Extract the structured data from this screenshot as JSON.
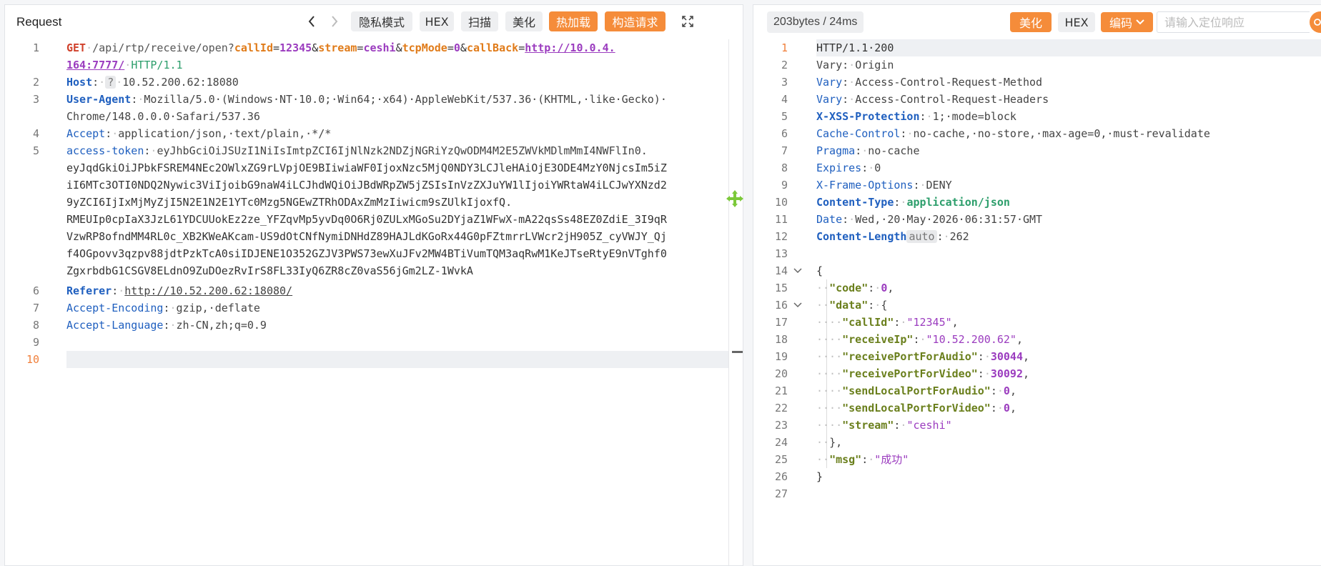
{
  "request": {
    "title": "Request",
    "toolbar": {
      "privacy": "隐私模式",
      "hex": "HEX",
      "scan": "扫描",
      "beautify": "美化",
      "hot_reload": "热加载",
      "construct": "构造请求"
    },
    "lines": [
      1,
      2,
      3,
      4,
      5,
      6,
      7,
      8,
      9,
      10
    ],
    "current_line": 10,
    "l1": {
      "method": "GET",
      "path": "/api/rtp/receive/open?",
      "k1": "callId",
      "v1": "12345",
      "k2": "stream",
      "v2": "ceshi",
      "k3": "tcpMode",
      "v3": "0",
      "k4": "callBack",
      "url_a": "http://10.0.4.",
      "url_b": "164:7777/",
      "proto": "HTTP/1.1"
    },
    "host": {
      "key": "Host",
      "badge": "?",
      "value": "10.52.200.62:18080"
    },
    "ua": {
      "key": "User-Agent",
      "value_a": "Mozilla/5.0·(Windows·NT·10.0;·Win64;·x64)·AppleWebKit/537.36·(KHTML,·like·Gecko)·",
      "value_b": "Chrome/148.0.0.0·Safari/537.36"
    },
    "accept": {
      "key": "Accept",
      "value": "application/json,·text/plain,·*/*"
    },
    "token": {
      "key": "access-token",
      "lines": [
        "eyJhbGciOiJSUzI1NiIsImtpZCI6IjNlNzk2NDZjNGRiYzQwODM4M2E5ZWVkMDlmMmI4NWFlIn0.",
        "eyJqdGkiOiJPbkFSREM4NEc2OWlxZG9rLVpjOE9BIiwiaWF0IjoxNzc5MjQ0NDY3LCJleHAiOjE3ODE4MzY0NjcsIm5iZ",
        "iI6MTc3OTI0NDQ2Nywic3ViIjoibG9naW4iLCJhdWQiOiJBdWRpZW5jZSIsInVzZXJuYW1lIjoiYWRtaW4iLCJwYXNzd2",
        "9yZCI6IjIxMjMyZjI5N2E1N2E1YTc0Mzg5NGEwZTRhODAxZmMzIiwicm9sZUlkIjoxfQ.",
        "RMEUIp0cpIaX3JzL61YDCUUokEz2ze_YFZqvMp5yvDq0O6Rj0ZULxMGoSu2DYjaZ1WFwX-mA22qsSs48EZ0ZdiE_3I9qR",
        "VzwRP8ofndMM4RL0c_XB2KWeAKcam-US9dOtCNfNymiDNHdZ89HAJLdKGoRx44G0pFZtmrrLVWcr2jH905Z_cyVWJY_Qj",
        "f4OGpovv3qzpv88jdtPzkTcA0siIDJENE1O352GZJV3PWS73ewXuJFv2MW4BTiVumTQM3aqRwM1KeJTseRtyE9nVTghf0",
        "ZgxrbdbG1CSGV8ELdnO9ZuDOezRvIrS8FL33IyQ6ZR8cZ0vaS56jGm2LZ-1WvkA"
      ]
    },
    "referer": {
      "key": "Referer",
      "value": "http://10.52.200.62:18080/"
    },
    "encoding": {
      "key": "Accept-Encoding",
      "value": "gzip,·deflate"
    },
    "language": {
      "key": "Accept-Language",
      "value": "zh-CN,zh;q=0.9"
    }
  },
  "response": {
    "stats": "203bytes / 24ms",
    "toolbar": {
      "beautify": "美化",
      "hex": "HEX",
      "encoding": "编码"
    },
    "search_placeholder": "请输入定位响应",
    "lines": [
      1,
      2,
      3,
      4,
      5,
      6,
      7,
      8,
      9,
      10,
      11,
      12,
      13,
      14,
      15,
      16,
      17,
      18,
      19,
      20,
      21,
      22,
      23,
      24,
      25,
      26,
      27
    ],
    "status": "HTTP/1.1·200",
    "headers": [
      {
        "key": "Vary",
        "value": "Origin",
        "bold": false
      },
      {
        "key": "Vary",
        "value": "Access-Control-Request-Method",
        "bold": false
      },
      {
        "key": "Vary",
        "value": "Access-Control-Request-Headers",
        "bold": false
      },
      {
        "key": "X-XSS-Protection",
        "value": "1;·mode=block",
        "bold": true
      },
      {
        "key": "Cache-Control",
        "value": "no-cache,·no-store,·max-age=0,·must-revalidate",
        "bold": false
      },
      {
        "key": "Pragma",
        "value": "no-cache",
        "bold": false
      },
      {
        "key": "Expires",
        "value": "0",
        "bold": false
      },
      {
        "key": "X-Frame-Options",
        "value": "DENY",
        "bold": false
      },
      {
        "key": "Content-Type",
        "value": "application/json",
        "bold": true
      },
      {
        "key": "Date",
        "value": "Wed,·20·May·2026·06:31:57·GMT",
        "bold": false
      }
    ],
    "content_length": {
      "key": "Content-Length",
      "badge": "auto",
      "value": "262"
    },
    "json": {
      "open": "{",
      "code_key": "\"code\"",
      "code_val": "0",
      "data_key": "\"data\"",
      "data_open": "{",
      "callId_key": "\"callId\"",
      "callId_val": "\"12345\"",
      "receiveIp_key": "\"receiveIp\"",
      "receiveIp_val": "\"10.52.200.62\"",
      "rpa_key": "\"receivePortForAudio\"",
      "rpa_val": "30044",
      "rpv_key": "\"receivePortForVideo\"",
      "rpv_val": "30092",
      "slpa_key": "\"sendLocalPortForAudio\"",
      "slpa_val": "0",
      "slpv_key": "\"sendLocalPortForVideo\"",
      "slpv_val": "0",
      "stream_key": "\"stream\"",
      "stream_val": "\"ceshi\"",
      "data_close": "},",
      "msg_key": "\"msg\"",
      "msg_val": "\"成功\"",
      "close": "}"
    }
  }
}
